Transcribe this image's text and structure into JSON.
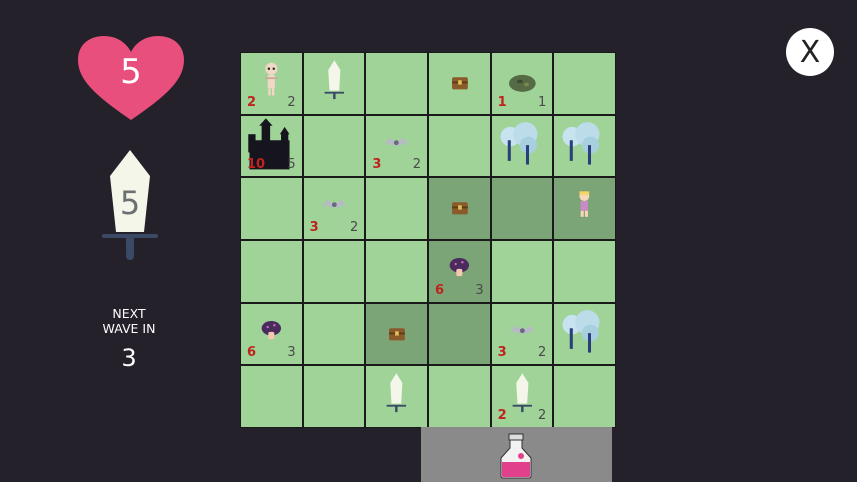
{
  "hud": {
    "health": "5",
    "weapon_power": "5",
    "next_wave_label_1": "NEXT",
    "next_wave_label_2": "WAVE IN",
    "next_wave_count": "3",
    "close_label": "X"
  },
  "colors": {
    "heart": "#e84f7c",
    "tile": "#9fd398",
    "tile_highlight": "#7ca577",
    "background": "#24212b",
    "attack": "#c0231e"
  },
  "board": {
    "rows": 6,
    "cols": 6,
    "cells": [
      {
        "item": "skeleton",
        "atk": "2",
        "hp": "2"
      },
      {
        "item": "sword"
      },
      {},
      {
        "item": "chest"
      },
      {
        "item": "slime",
        "atk": "1",
        "hp": "1"
      },
      {},
      {
        "item": "castle",
        "atk": "10",
        "hp": "5"
      },
      {},
      {
        "item": "bat",
        "atk": "3",
        "hp": "2"
      },
      {},
      {
        "item": "tree"
      },
      {
        "item": "tree"
      },
      {},
      {
        "item": "bat",
        "atk": "3",
        "hp": "2"
      },
      {},
      {
        "item": "chest",
        "highlight": true
      },
      {
        "highlight": true
      },
      {
        "item": "hero",
        "highlight": true
      },
      {},
      {},
      {},
      {
        "item": "mushroom",
        "atk": "6",
        "hp": "3",
        "highlight": true
      },
      {},
      {},
      {
        "item": "mushroom",
        "atk": "6",
        "hp": "3"
      },
      {},
      {
        "item": "chest",
        "highlight": true
      },
      {
        "highlight": true
      },
      {
        "item": "bat",
        "atk": "3",
        "hp": "2"
      },
      {
        "item": "tree"
      },
      {},
      {},
      {
        "item": "sword"
      },
      {},
      {
        "item": "sword",
        "atk": "2",
        "hp": "2"
      },
      {}
    ]
  },
  "inventory": {
    "item": "potion-icon"
  }
}
